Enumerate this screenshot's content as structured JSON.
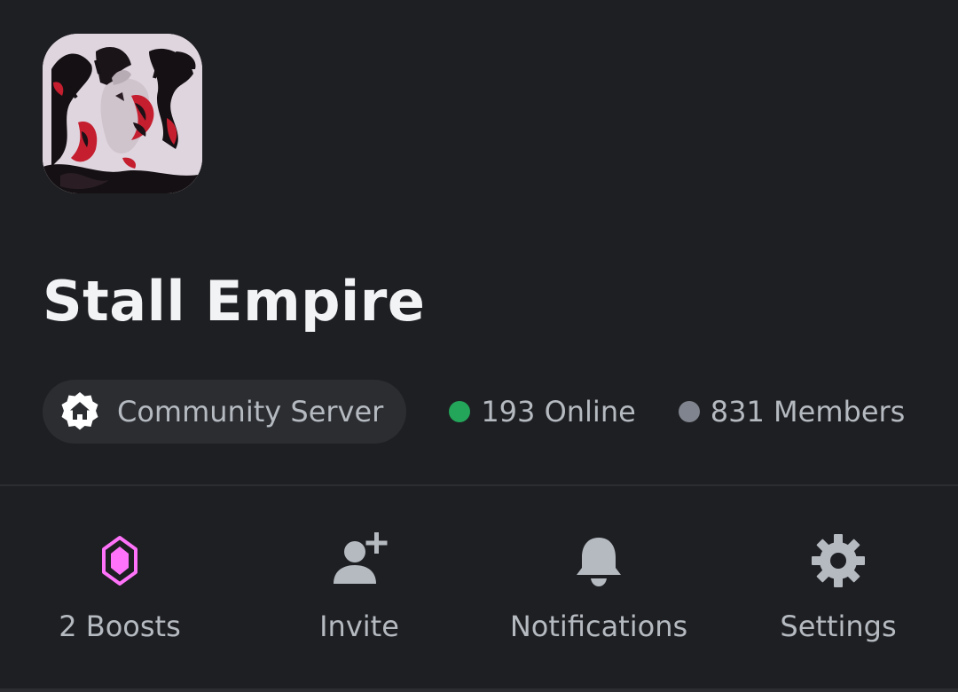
{
  "server": {
    "name": "Stall Empire",
    "avatar_icon": "server-avatar-art"
  },
  "info": {
    "community_label": "Community Server",
    "community_icon": "community-badge-icon",
    "online_text": "193 Online",
    "online_color": "#23a55a",
    "members_text": "831 Members",
    "members_color": "#80848e"
  },
  "actions": {
    "boosts": {
      "label": "2 Boosts",
      "icon": "boost-gem-icon",
      "color": "#ff73fa"
    },
    "invite": {
      "label": "Invite",
      "icon": "add-user-icon"
    },
    "notifications": {
      "label": "Notifications",
      "icon": "bell-icon"
    },
    "settings": {
      "label": "Settings",
      "icon": "gear-icon"
    }
  },
  "colors": {
    "background": "#1e1f22",
    "surface": "#2b2d31",
    "text_primary": "#f2f3f5",
    "text_secondary": "#b5bac1"
  }
}
